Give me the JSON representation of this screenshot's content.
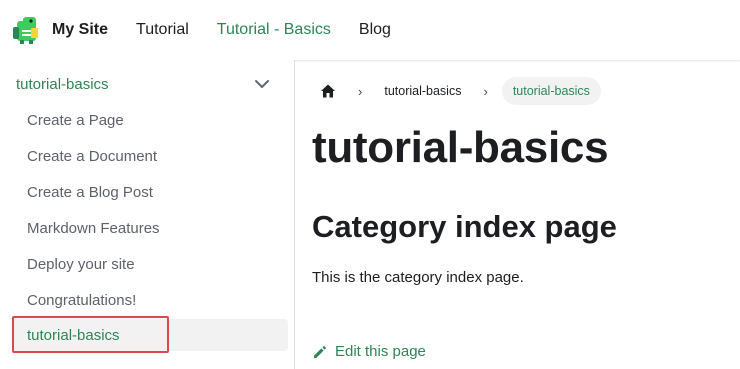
{
  "navbar": {
    "logo_icon": "dinosaur-logo-icon",
    "brand_title": "My Site",
    "links": [
      {
        "label": "Tutorial",
        "active": false
      },
      {
        "label": "Tutorial - Basics",
        "active": true
      },
      {
        "label": "Blog",
        "active": false
      }
    ]
  },
  "sidebar": {
    "category": {
      "label": "tutorial-basics",
      "icon": "chevron-down-icon",
      "expanded": true
    },
    "items": [
      {
        "label": "Create a Page",
        "active": false
      },
      {
        "label": "Create a Document",
        "active": false
      },
      {
        "label": "Create a Blog Post",
        "active": false
      },
      {
        "label": "Markdown Features",
        "active": false
      },
      {
        "label": "Deploy your site",
        "active": false
      },
      {
        "label": "Congratulations!",
        "active": false
      },
      {
        "label": "tutorial-basics",
        "active": true
      }
    ]
  },
  "breadcrumbs": {
    "home_icon": "home-icon",
    "separator": "›",
    "items": [
      {
        "label": "tutorial-basics",
        "active": false
      },
      {
        "label": "tutorial-basics",
        "active": true
      }
    ]
  },
  "content": {
    "title": "tutorial-basics",
    "heading": "Category index page",
    "paragraph": "This is the category index page.",
    "edit_link": {
      "icon": "pencil-icon",
      "label": "Edit this page"
    }
  },
  "colors": {
    "accent": "#2e8555",
    "highlight_border": "#e0474c",
    "active_bg": "#f2f2f2",
    "text": "#1c1e21",
    "muted_text": "#5d6169"
  }
}
